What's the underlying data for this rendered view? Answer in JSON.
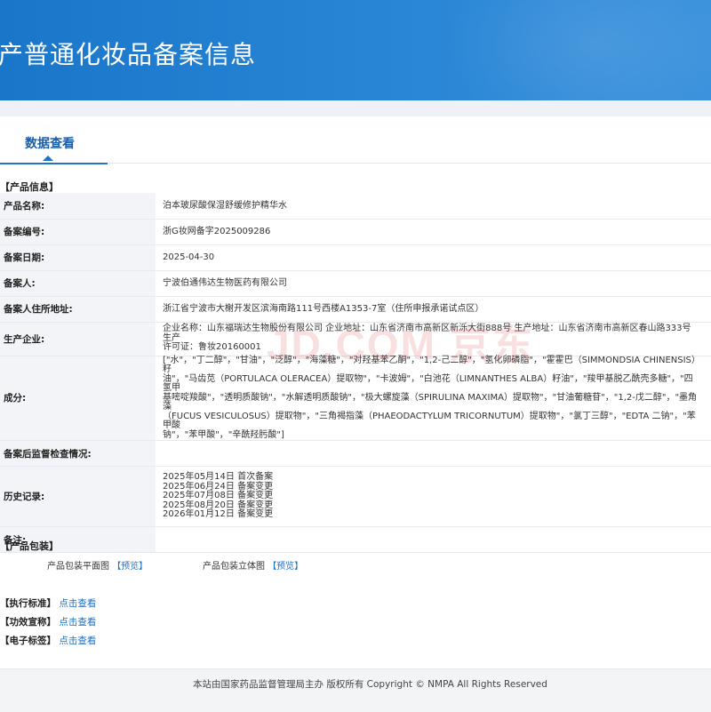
{
  "header": {
    "title": "产普通化妆品备案信息"
  },
  "tabs": [
    {
      "label": "数据查看"
    }
  ],
  "product_info": {
    "section_title": "【产品信息】",
    "rows": [
      {
        "label": "产品名称:",
        "value": "泊本玻尿酸保湿舒缓修护精华水"
      },
      {
        "label": "备案编号:",
        "value": "浙G妆网备字2025009286"
      },
      {
        "label": "备案日期:",
        "value": "2025-04-30"
      },
      {
        "label": "备案人:",
        "value": "宁波伯通伟达生物医药有限公司"
      },
      {
        "label": "备案人住所地址:",
        "value": "浙江省宁波市大榭开发区滨海南路111号西楼A1353-7室（住所申报承诺试点区）"
      },
      {
        "label": "生产企业:",
        "value_lines": [
          "企业名称：山东福瑞达生物股份有限公司 企业地址：山东省济南市高新区新泺大街888号 生产地址：山东省济南市高新区春山路333号 生产",
          "许可证：鲁妆20160001"
        ]
      },
      {
        "label": "成分:",
        "value_lines": [
          "[\"水\"，\"丁二醇\"，\"甘油\"，\"泛醇\"，\"海藻糖\"，\"对羟基苯乙酮\"，\"1,2-己二醇\"，\"氢化卵磷脂\"，\"霍霍巴（SIMMONDSIA CHINENSIS）籽",
          "油\"，\"马齿苋（PORTULACA OLERACEA）提取物\"，\"卡波姆\"，\"白池花（LIMNANTHES ALBA）籽油\"，\"羧甲基脱乙酰壳多糖\"，\"四氢甲",
          "基嘧啶羧酸\"，\"透明质酸钠\"，\"水解透明质酸钠\"，\"极大螺旋藻（SPIRULINA MAXIMA）提取物\"，\"甘油葡糖苷\"，\"1,2-戊二醇\"，\"墨角藻",
          "（FUCUS VESICULOSUS）提取物\"，\"三角褐指藻（PHAEODACTYLUM TRICORNUTUM）提取物\"，\"氯丁三醇\"，\"EDTA 二钠\"，\"苯甲酸",
          "钠\"，\"苯甲酸\"，\"辛酰羟肟酸\"]"
        ]
      },
      {
        "label": "备案后监督检查情况:",
        "value": ""
      },
      {
        "label": "历史记录:",
        "value_lines": [
          "2025年05月14日 首次备案",
          "2025年06月24日 备案变更",
          "2025年07月08日 备案变更",
          "2025年08月20日 备案变更",
          "2026年01月12日 备案变更"
        ]
      },
      {
        "label": "备注:",
        "value": ""
      }
    ]
  },
  "packaging": {
    "section_title": "【产品包装】",
    "flat_label": "产品包装平面图",
    "solid_label": "产品包装立体图",
    "preview_link": "【预览】"
  },
  "links": [
    {
      "label": "【执行标准】",
      "link": "点击查看"
    },
    {
      "label": "【功效宣称】",
      "link": "点击查看"
    },
    {
      "label": "【电子标签】",
      "link": "点击查看"
    }
  ],
  "watermark": "JD.COM 京东",
  "footer": {
    "text": "本站由国家药品监督管理局主办 版权所有 Copyright © NMPA All Rights Reserved"
  },
  "colors": {
    "banner": "#1a76c9",
    "accent": "#1f73c6",
    "link": "#1f6fbf",
    "label_bg": "#f2f4f7"
  }
}
